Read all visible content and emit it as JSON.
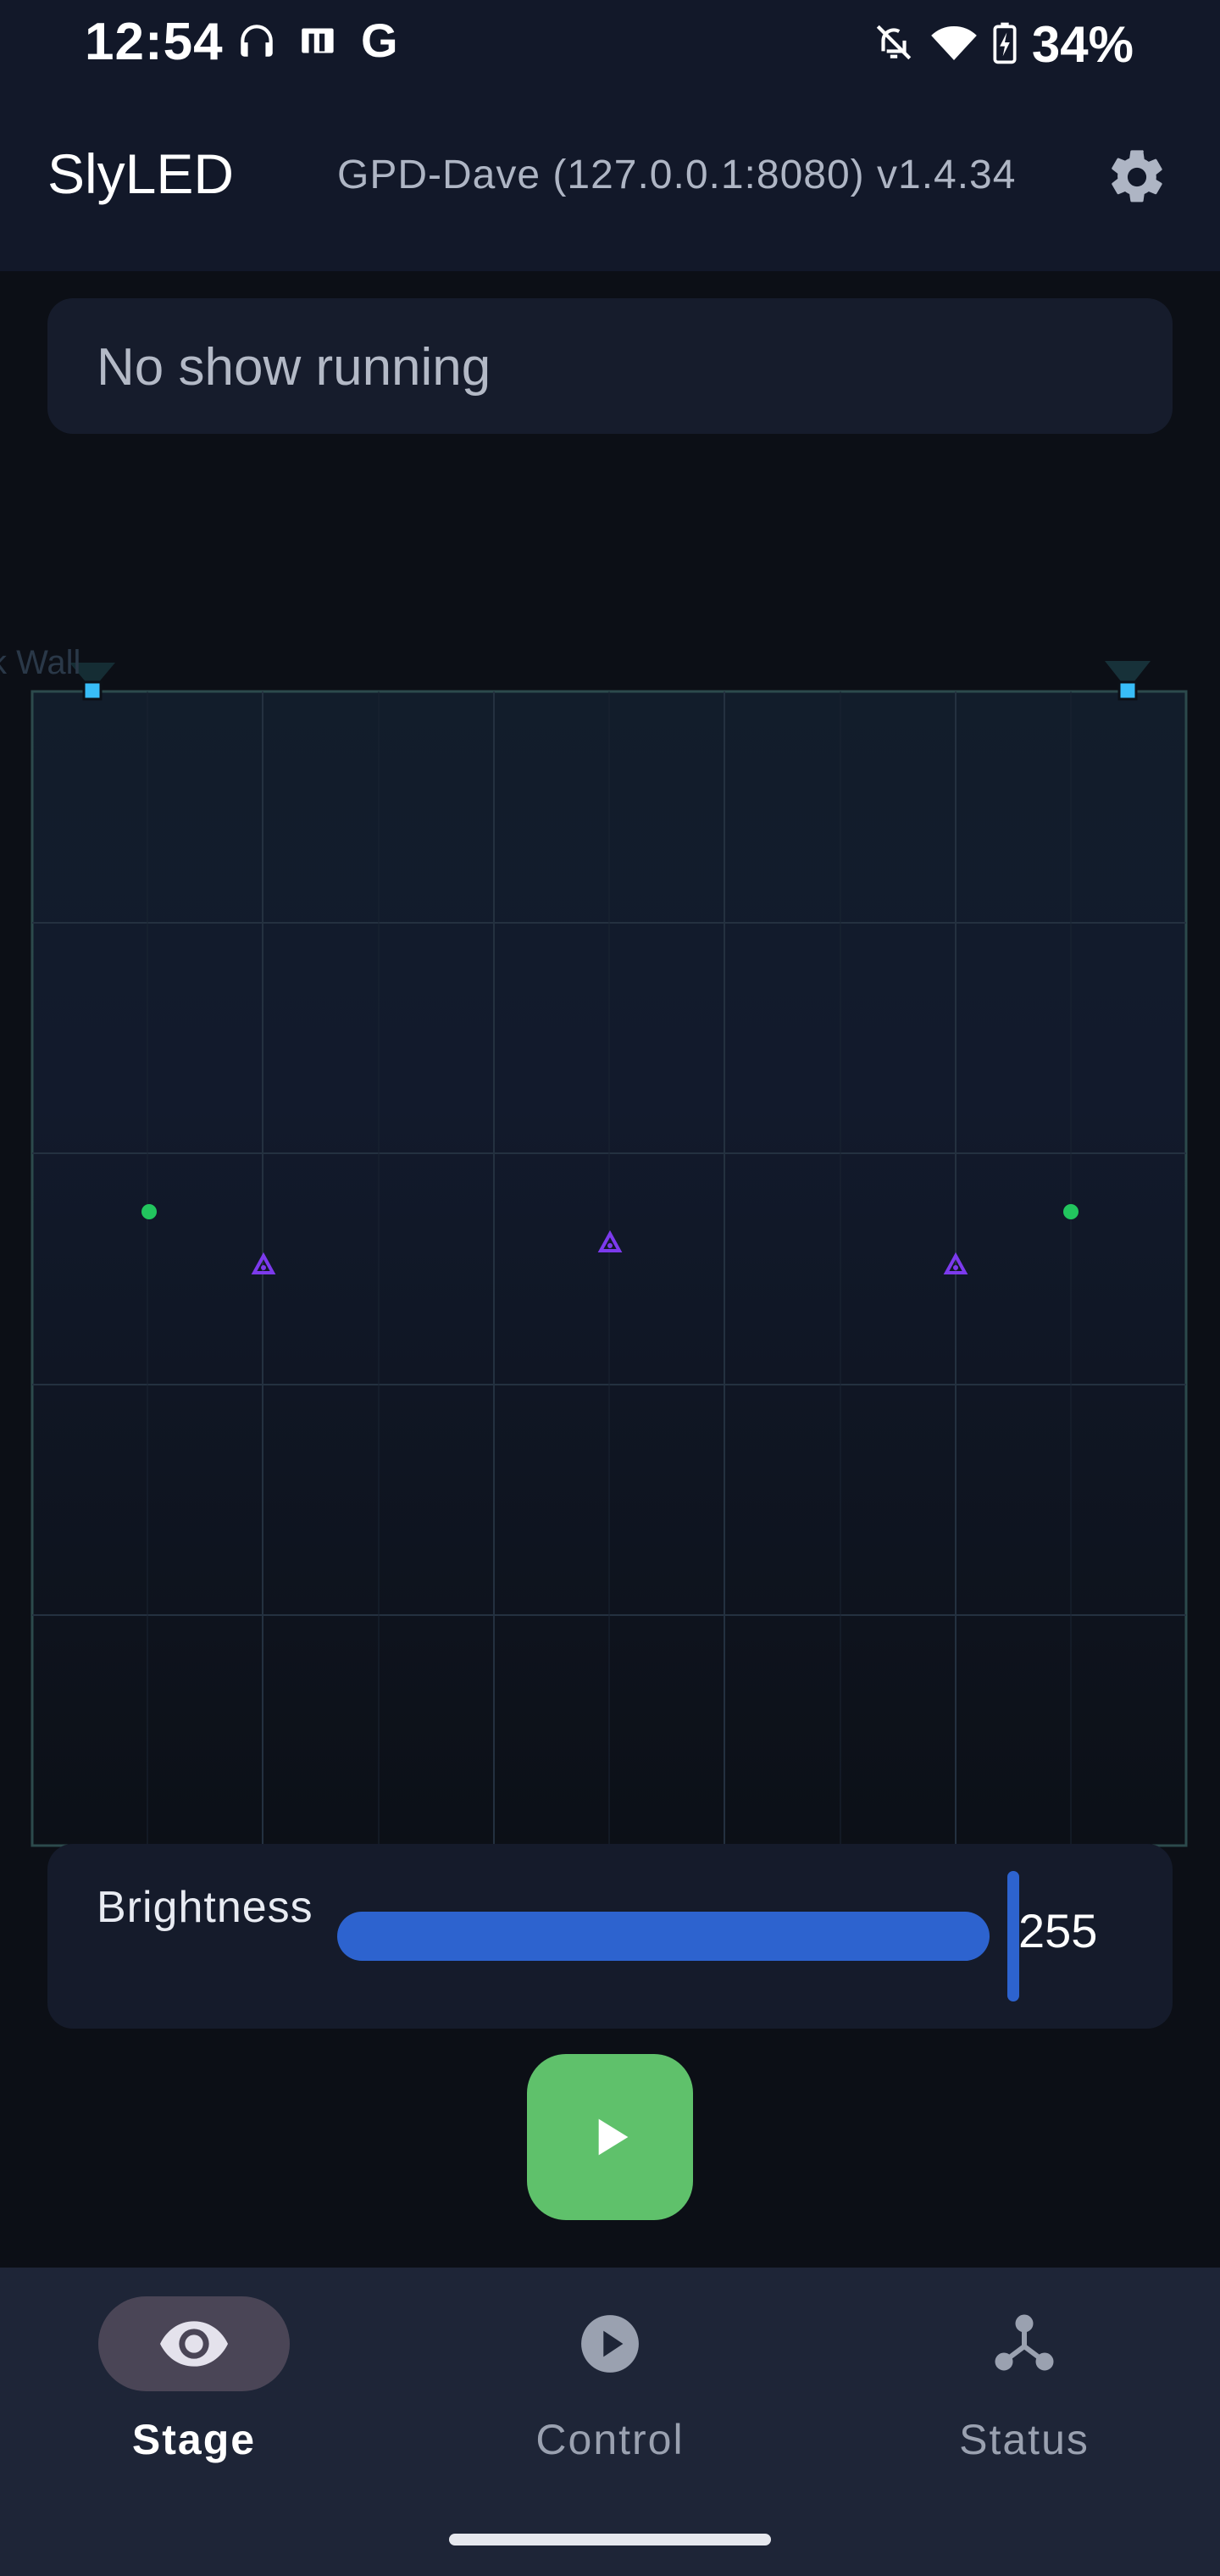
{
  "status_bar": {
    "time": "12:54",
    "left_icons": [
      "headphones-icon",
      "cast-icon",
      "google-icon"
    ],
    "google_glyph": "G",
    "right_icons": [
      "notifications-off-icon",
      "wifi-icon",
      "battery-charging-icon"
    ],
    "battery_percent": "34%"
  },
  "app_bar": {
    "title": "SlyLED",
    "server_info": "GPD-Dave (127.0.0.1:8080) v1.4.34",
    "settings_icon": "gear-icon"
  },
  "show_status": {
    "text": "No show running"
  },
  "stage": {
    "surface_label": "ck Wall",
    "colors": {
      "background": "#111827",
      "grid": "#233040",
      "border": "#2c4a4c",
      "camera": "#38bdf8",
      "moving_head": "#7c3aed",
      "led": "#22c55e"
    }
  },
  "brightness": {
    "label": "Brightness",
    "value": "255",
    "level_fraction": 1.0,
    "accent_color": "#2d63cf"
  },
  "play_button": {
    "icon": "play-icon",
    "color": "#5fc16b"
  },
  "bottom_nav": {
    "items": [
      {
        "label": "Stage",
        "icon": "eye-icon",
        "active": true
      },
      {
        "label": "Control",
        "icon": "play-circle-icon",
        "active": false
      },
      {
        "label": "Status",
        "icon": "hub-icon",
        "active": false
      }
    ]
  }
}
